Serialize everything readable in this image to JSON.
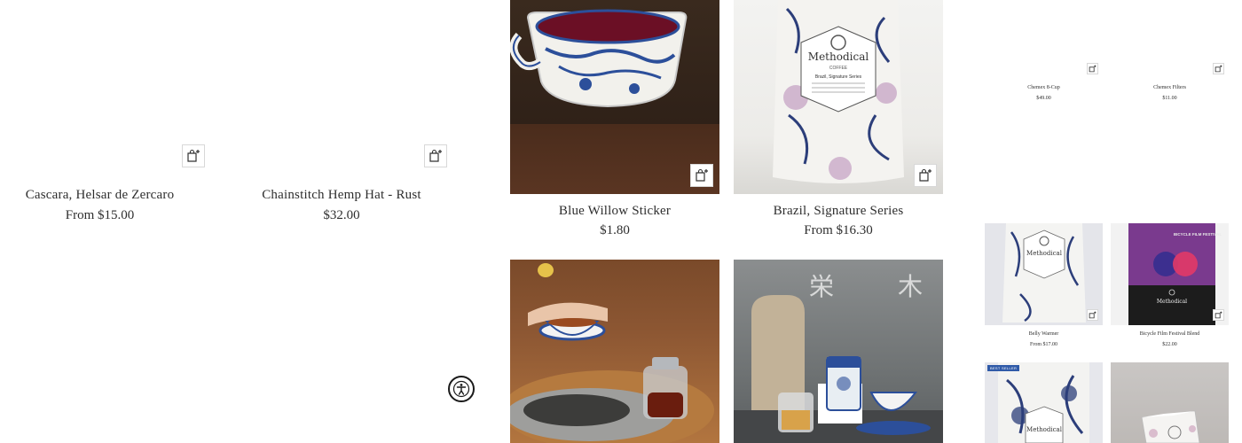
{
  "large_products": [
    {
      "title": "Cascara, Helsar de Zercaro",
      "price": "From $15.00"
    },
    {
      "title": "Chainstitch Hemp Hat - Rust",
      "price": "$32.00"
    },
    {
      "title": "Blue Willow Sticker",
      "price": "$1.80"
    },
    {
      "title": "Brazil, Signature Series",
      "price": "From $16.30"
    }
  ],
  "small_products": [
    {
      "title": "Chemex 8-Cup",
      "price": "$49.00"
    },
    {
      "title": "Chemex Filters",
      "price": "$11.00"
    },
    {
      "title": "Belly Warmer",
      "price": "From $17.00"
    },
    {
      "title": "Bicycle Film Festival Blend",
      "price": "$22.00"
    }
  ],
  "packaging": {
    "brand": "Methodical",
    "brand_sub": "COFFEE",
    "brazil_label": "Brazil, Signature Series",
    "bicycle_label": "BICYCLE FILM FESTIVAL"
  },
  "badges": {
    "best_seller": "BEST SELLER"
  },
  "icons": {
    "quick_add": "bag-plus-icon",
    "accessibility": "accessibility-icon"
  },
  "colors": {
    "text": "#2e2e2e",
    "willow_blue": "#2c4f9a",
    "bicycle_purple": "#7a3a8e",
    "badge_blue": "#2f5aa8"
  }
}
